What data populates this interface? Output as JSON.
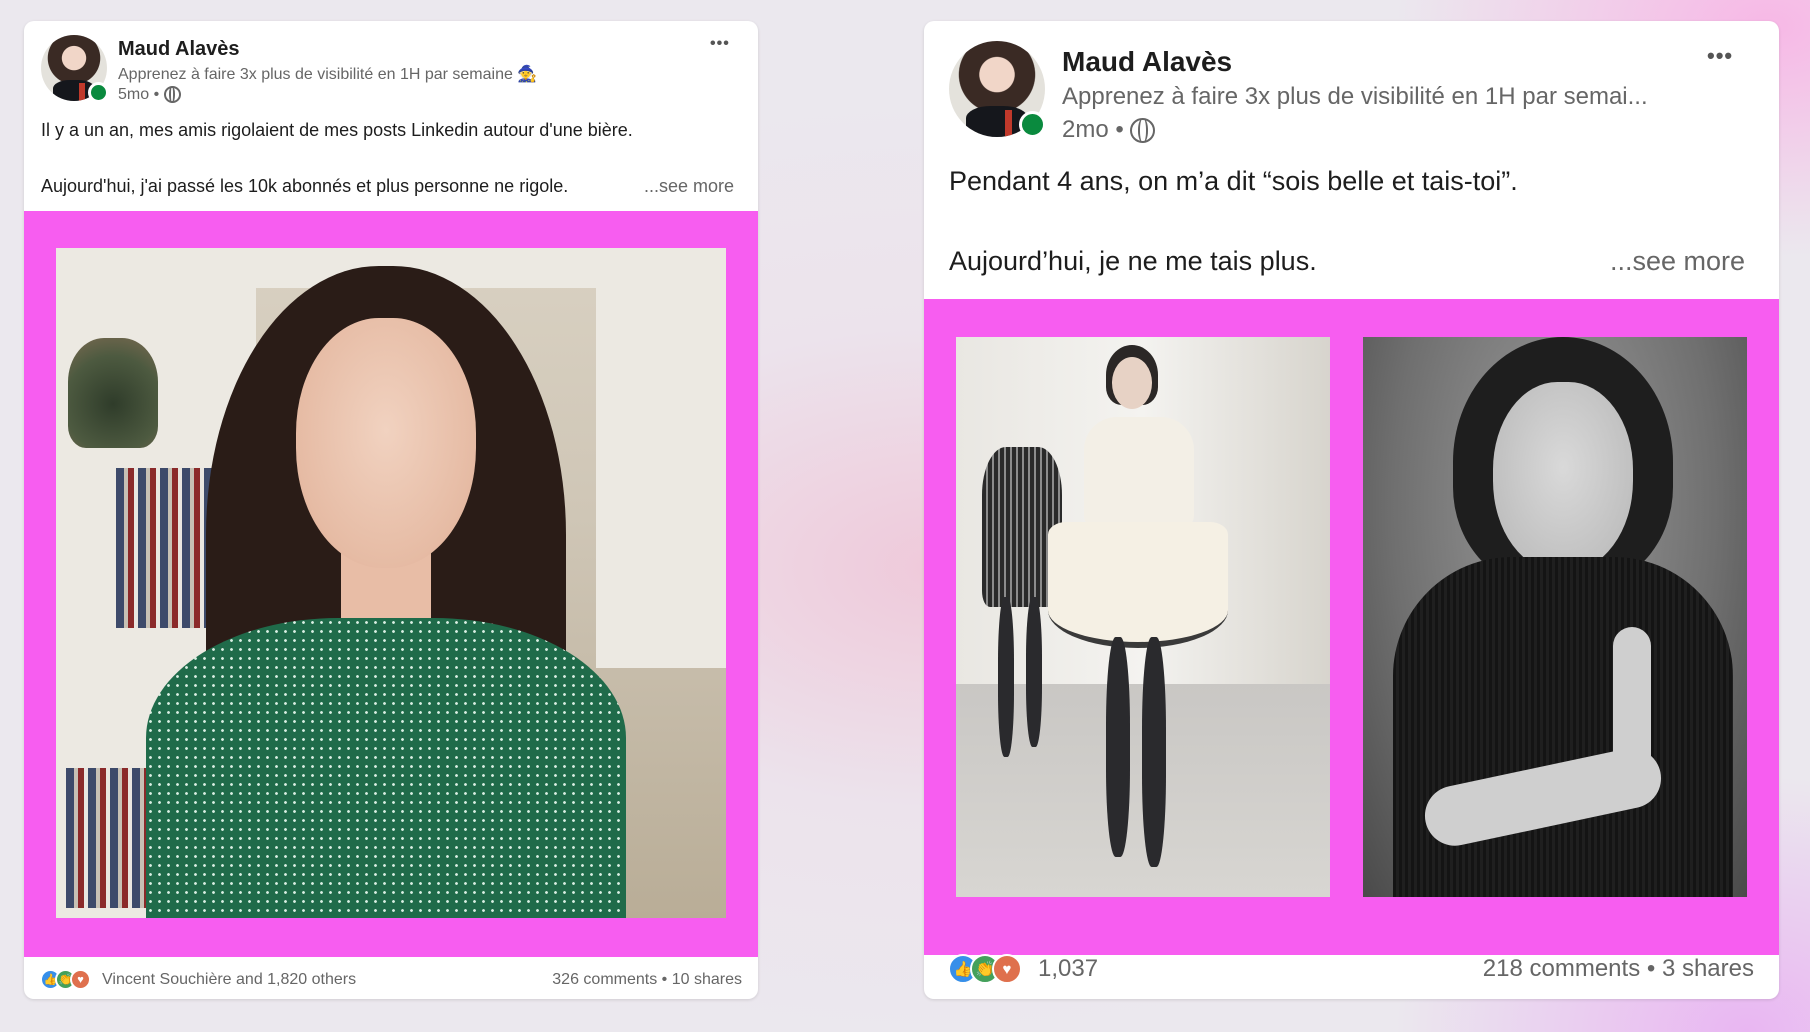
{
  "posts": [
    {
      "author": "Maud Alavès",
      "headline": "Apprenez à faire 3x plus de visibilité en 1H par semaine 🧙",
      "time": "5mo",
      "separator": "•",
      "more_icon": "•••",
      "line1": "Il y a un an, mes amis rigolaient de mes posts Linkedin autour d'une bière.",
      "line2": "Aujourd'hui, j'ai passé les 10k abonnés et plus personne ne rigole.",
      "see_more": "...see more",
      "reactions_text": "Vincent Souchière and 1,820 others",
      "comments": "326 comments",
      "shares": "10 shares",
      "dot": "•"
    },
    {
      "author": "Maud Alavès",
      "headline": "Apprenez à faire 3x plus de visibilité en 1H par semai...",
      "time": "2mo",
      "separator": "•",
      "more_icon": "•••",
      "line1": "Pendant 4 ans, on m’a dit “sois belle et tais-toi”.",
      "line2": "Aujourd’hui, je ne me tais plus.",
      "see_more": "...see more",
      "reactions_text": "1,037",
      "comments": "218 comments",
      "shares": "3 shares",
      "dot": "•"
    }
  ],
  "icons": [
    "ellipsis-icon",
    "globe-icon",
    "like-reaction-icon",
    "celebrate-reaction-icon",
    "love-reaction-icon"
  ],
  "colors": {
    "frame_pink": "#f75df0",
    "online_green": "#0a8a3e",
    "like_blue": "#378fe9",
    "celebrate_green": "#44a05b",
    "love_orange": "#df704d"
  }
}
